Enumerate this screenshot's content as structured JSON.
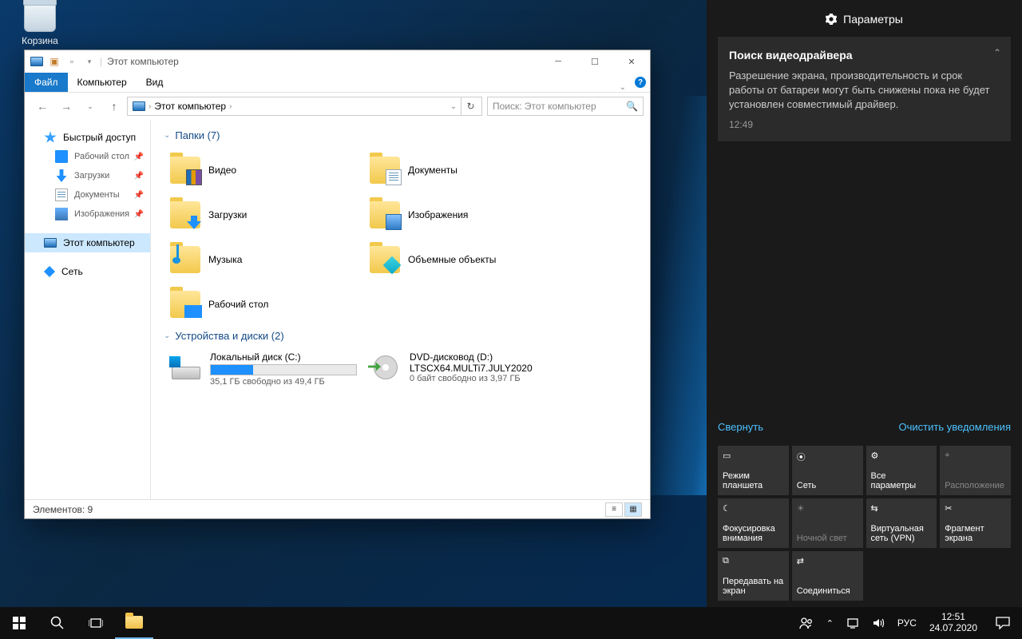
{
  "desktop": {
    "recycle_label": "Корзина"
  },
  "window": {
    "title": "Этот компьютер",
    "tabs": {
      "file": "Файл",
      "computer": "Компьютер",
      "view": "Вид"
    },
    "address": {
      "crumb1": "Этот компьютер"
    },
    "search_placeholder": "Поиск: Этот компьютер",
    "nav": {
      "quick": "Быстрый доступ",
      "desktop": "Рабочий стол",
      "downloads": "Загрузки",
      "documents": "Документы",
      "pictures": "Изображения",
      "thispc": "Этот компьютер",
      "network": "Сеть"
    },
    "groups": {
      "folders_label": "Папки (7)",
      "drives_label": "Устройства и диски (2)"
    },
    "folders": {
      "video": "Видео",
      "documents": "Документы",
      "downloads": "Загрузки",
      "pictures": "Изображения",
      "music": "Музыка",
      "objects3d": "Объемные объекты",
      "desktop": "Рабочий стол"
    },
    "drives": {
      "c_name": "Локальный диск (C:)",
      "c_free": "35,1 ГБ свободно из 49,4 ГБ",
      "c_fill_pct": 29,
      "d_name": "DVD-дисковод (D:)",
      "d_label": "LTSCX64.MULTi7.JULY2020",
      "d_free": "0 байт свободно из 3,97 ГБ"
    },
    "status": "Элементов: 9"
  },
  "action_center": {
    "header": "Параметры",
    "notif": {
      "title": "Поиск видеодрайвера",
      "body": "Разрешение экрана, производительность и срок работы от батареи могут быть снижены пока не будет установлен совместимый драйвер.",
      "time": "12:49"
    },
    "collapse": "Свернуть",
    "clear": "Очистить уведомления",
    "tiles": {
      "tablet": "Режим планшета",
      "network": "Сеть",
      "allsettings": "Все параметры",
      "location": "Расположение",
      "focus": "Фокусировка внимания",
      "nightlight": "Ночной свет",
      "vpn": "Виртуальная сеть (VPN)",
      "snip": "Фрагмент экрана",
      "project": "Передавать на экран",
      "connect": "Соединиться"
    }
  },
  "taskbar": {
    "lang": "РУС",
    "time": "12:51",
    "date": "24.07.2020"
  }
}
